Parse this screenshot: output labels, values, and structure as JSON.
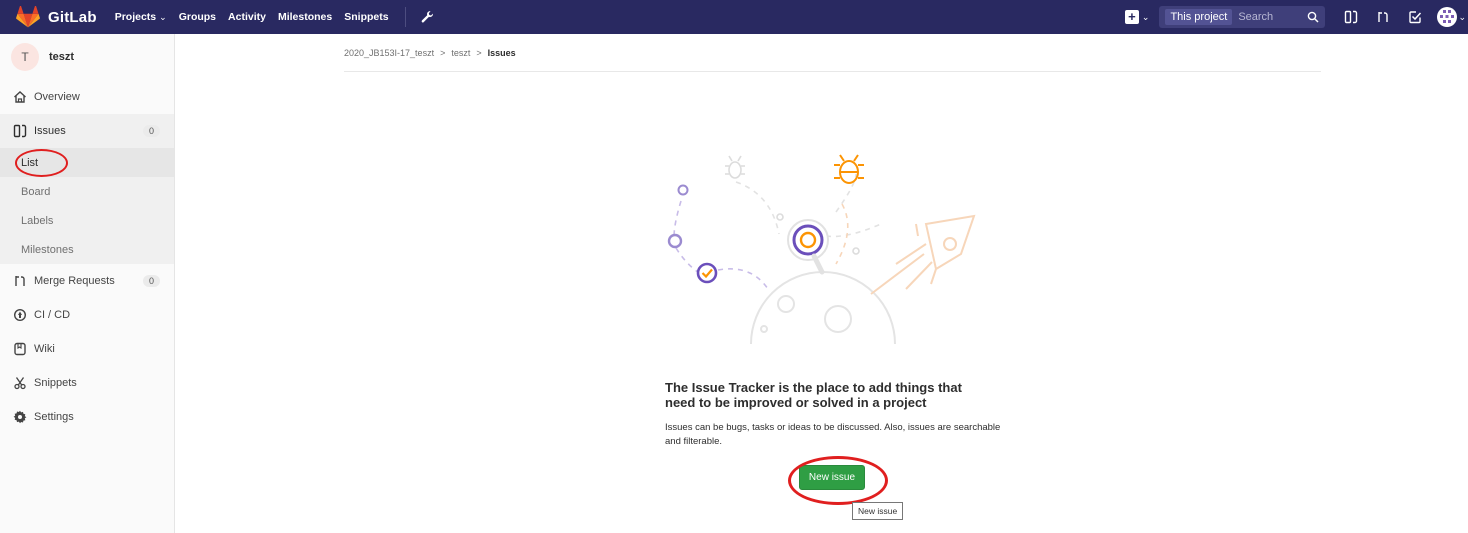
{
  "navbar": {
    "brand": "GitLab",
    "links": [
      {
        "label": "Projects",
        "has_dropdown": true
      },
      {
        "label": "Groups"
      },
      {
        "label": "Activity"
      },
      {
        "label": "Milestones"
      },
      {
        "label": "Snippets"
      }
    ],
    "search": {
      "scope": "This project",
      "placeholder": "Search"
    }
  },
  "sidebar": {
    "project_initial": "T",
    "project_name": "teszt",
    "items": [
      {
        "label": "Overview",
        "icon": "home-icon"
      },
      {
        "label": "Issues",
        "icon": "issues-icon",
        "count": "0"
      },
      {
        "label": "Merge Requests",
        "icon": "merge-request-icon",
        "count": "0"
      },
      {
        "label": "CI / CD",
        "icon": "rocket-icon"
      },
      {
        "label": "Wiki",
        "icon": "book-icon"
      },
      {
        "label": "Snippets",
        "icon": "scissors-icon"
      },
      {
        "label": "Settings",
        "icon": "gear-icon"
      }
    ],
    "issues_sub": [
      "List",
      "Board",
      "Labels",
      "Milestones"
    ]
  },
  "breadcrumb": [
    "2020_JB153I-17_teszt",
    "teszt",
    "Issues"
  ],
  "empty_state": {
    "title": "The Issue Tracker is the place to add things that need to be improved or solved in a project",
    "description": "Issues can be bugs, tasks or ideas to be discussed. Also, issues are searchable and filterable.",
    "button": "New issue",
    "tooltip": "New issue"
  },
  "colors": {
    "navbar": "#292961",
    "button_green": "#2f9e44",
    "annotation_red": "#e01f1f",
    "illustration_purple": "#6b4fbb",
    "illustration_orange": "#fc9403"
  }
}
